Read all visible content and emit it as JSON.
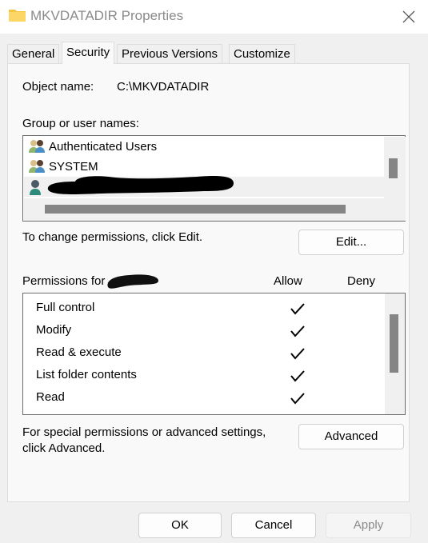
{
  "window": {
    "title": "MKVDATADIR Properties",
    "icon": "folder-icon",
    "close_icon": "close-icon"
  },
  "tabs": [
    {
      "label": "General"
    },
    {
      "label": "Security",
      "active": true
    },
    {
      "label": "Previous Versions"
    },
    {
      "label": "Customize"
    }
  ],
  "security": {
    "object_name_label": "Object name:",
    "object_name_value": "C:\\MKVDATADIR",
    "group_label": "Group or user names:",
    "groups": [
      {
        "name": "Authenticated Users",
        "icon": "group-icon"
      },
      {
        "name": "SYSTEM",
        "icon": "group-icon"
      },
      {
        "name": "",
        "icon": "user-icon",
        "selected": true,
        "redacted": true
      }
    ],
    "change_text": "To change permissions, click Edit.",
    "edit_button": "Edit...",
    "permissions_label": "Permissions for",
    "allow_header": "Allow",
    "deny_header": "Deny",
    "permissions": [
      {
        "name": "Full control",
        "allow": true,
        "deny": false
      },
      {
        "name": "Modify",
        "allow": true,
        "deny": false
      },
      {
        "name": "Read & execute",
        "allow": true,
        "deny": false
      },
      {
        "name": "List folder contents",
        "allow": true,
        "deny": false
      },
      {
        "name": "Read",
        "allow": true,
        "deny": false
      }
    ],
    "advanced_text_1": "For special permissions or advanced settings,",
    "advanced_text_2": "click Advanced.",
    "advanced_button": "Advanced"
  },
  "footer": {
    "ok": "OK",
    "cancel": "Cancel",
    "apply": "Apply",
    "apply_enabled": false
  }
}
